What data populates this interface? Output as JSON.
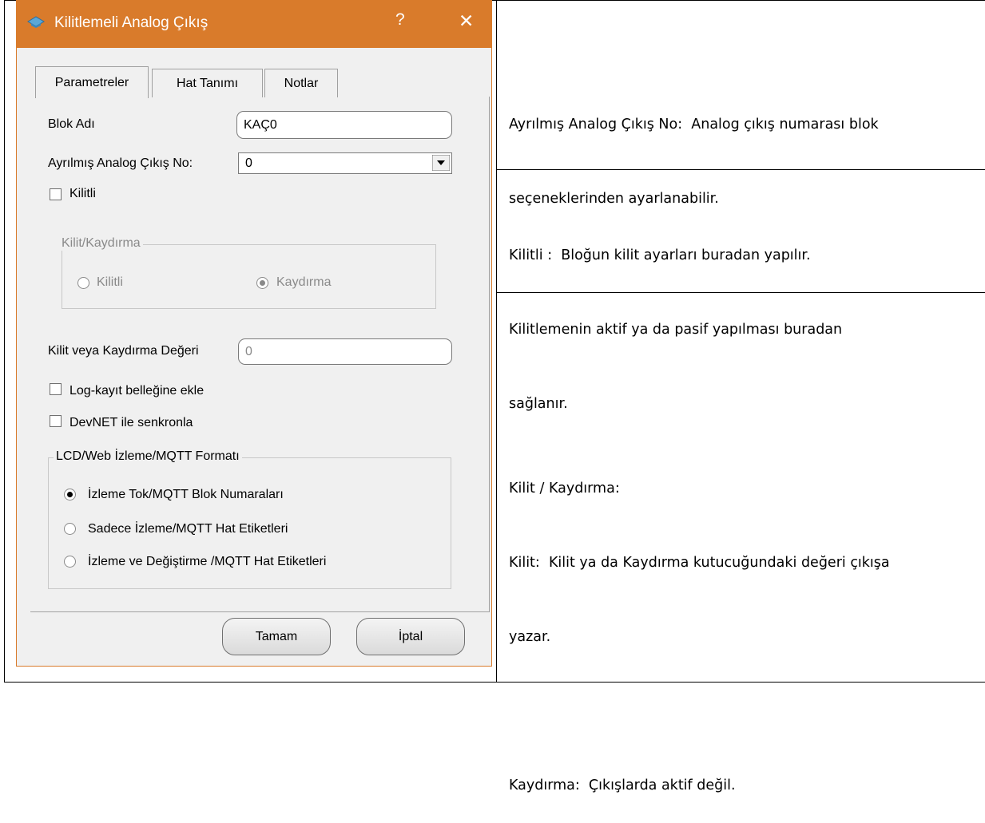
{
  "dialog": {
    "title": "Kilitlemeli Analog Çıkış",
    "help_label": "?",
    "close_label": "✕",
    "tabs": [
      {
        "label": "Parametreler",
        "active": true
      },
      {
        "label": "Hat Tanımı",
        "active": false
      },
      {
        "label": "Notlar",
        "active": false
      }
    ],
    "block_name": {
      "label": "Blok Adı",
      "value": "KAÇ0"
    },
    "reserved_output": {
      "label": "Ayrılmış Analog Çıkış No:",
      "value": "0"
    },
    "locked_checkbox": {
      "label": "Kilitli",
      "checked": false
    },
    "lock_group": {
      "legend": "Kilit/Kaydırma",
      "options": [
        {
          "label": "Kilitli",
          "selected": false
        },
        {
          "label": "Kaydırma",
          "selected": true
        }
      ]
    },
    "lock_value": {
      "label": "Kilit veya Kaydırma Değeri",
      "value": "0"
    },
    "log_checkbox": {
      "label": "Log-kayıt belleğine ekle",
      "checked": false
    },
    "devnet_checkbox": {
      "label": "DevNET ile senkronla",
      "checked": false
    },
    "format_group": {
      "legend": "LCD/Web İzleme/MQTT Formatı",
      "options": [
        {
          "label": "İzleme Tok/MQTT Blok Numaraları",
          "selected": true
        },
        {
          "label": "Sadece İzleme/MQTT Hat Etiketleri",
          "selected": false
        },
        {
          "label": "İzleme ve Değiştirme /MQTT Hat Etiketleri",
          "selected": false
        }
      ]
    },
    "ok_label": "Tamam",
    "cancel_label": "İptal",
    "accent_color": "#d97b2b"
  },
  "descriptions": {
    "reserved_output": [
      "Ayrılmış Analog Çıkış No:  Analog çıkış numarası blok",
      "seçeneklerinden ayarlanabilir."
    ],
    "locked": [
      "Kilitli :  Bloğun kilit ayarları buradan yapılır.",
      "Kilitlemenin aktif ya da pasif yapılması buradan",
      "sağlanır."
    ],
    "lock_shift": [
      "Kilit / Kaydırma:",
      "Kilit:  Kilit ya da Kaydırma kutucuğundaki değeri çıkışa",
      "yazar.",
      "",
      "Kaydırma:  Çıkışlarda aktif değil."
    ]
  }
}
